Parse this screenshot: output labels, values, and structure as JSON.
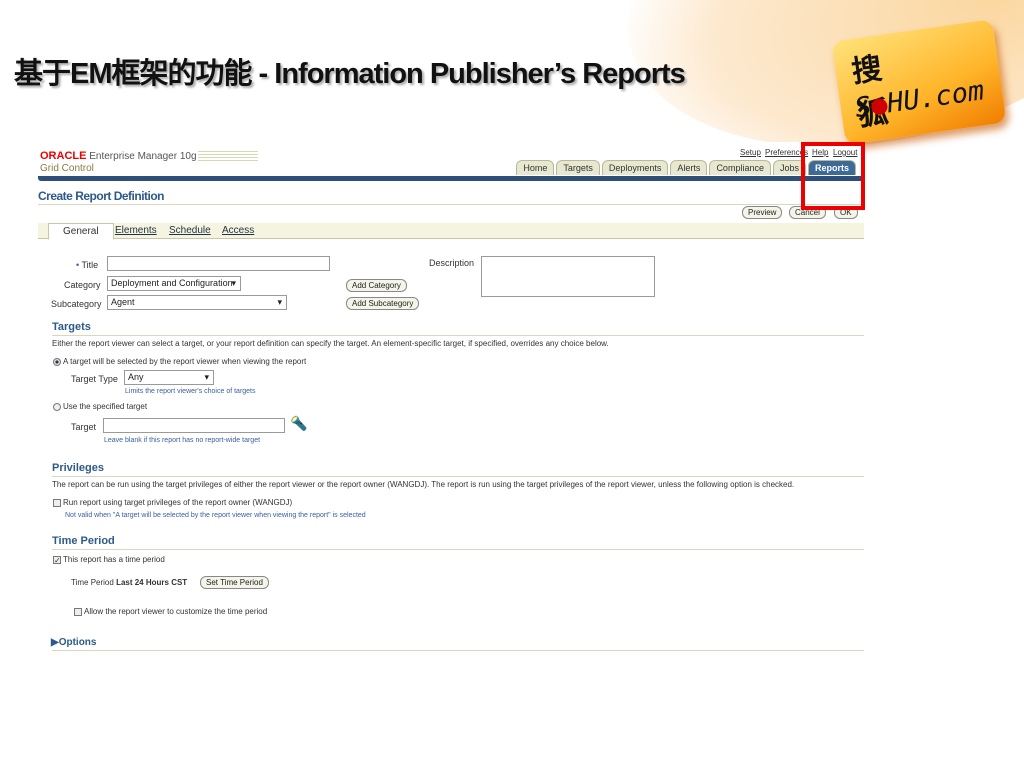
{
  "slide": {
    "title": "基于EM框架的功能 - Information Publisher’s Reports",
    "logo_cn": "搜 狐",
    "logo_en_pre": "S",
    "logo_en_dot": "●",
    "logo_en_post": "HU.com"
  },
  "app": {
    "oracle": "ORACLE",
    "product": "Enterprise Manager 10g",
    "subtitle": "Grid Control"
  },
  "global_links": [
    "Setup",
    "Preferences",
    "Help",
    "Logout"
  ],
  "tabs": [
    "Home",
    "Targets",
    "Deployments",
    "Alerts",
    "Compliance",
    "Jobs",
    "Reports"
  ],
  "page": {
    "title": "Create Report Definition",
    "buttons": {
      "preview": "Preview",
      "cancel": "Cancel",
      "ok": "OK"
    }
  },
  "subtabs": [
    "General",
    "Elements",
    "Schedule",
    "Access"
  ],
  "form": {
    "title_label": "Title",
    "title_value": "",
    "category_label": "Category",
    "category_value": "Deployment and Configuration",
    "subcategory_label": "Subcategory",
    "subcategory_value": "Agent",
    "add_category": "Add Category",
    "add_subcategory": "Add Subcategory",
    "description_label": "Description",
    "description_value": ""
  },
  "targets": {
    "heading": "Targets",
    "desc": "Either the report viewer can select a target, or your report definition can specify the target. An element-specific target, if specified, overrides any choice below.",
    "option1": "A target will be selected by the report viewer when viewing the report",
    "target_type_label": "Target Type",
    "target_type_value": "Any",
    "target_type_help": "Limits the report viewer's choice of targets",
    "option2": "Use the specified target",
    "target_label": "Target",
    "target_value": "",
    "target_help": "Leave blank if this report has no report-wide target"
  },
  "privileges": {
    "heading": "Privileges",
    "desc": "The report can be run using the target privileges of either the report viewer or the report owner (WANGDJ). The report is run using the target privileges of the report viewer, unless the following option is checked.",
    "checkbox": "Run report using target privileges of the report owner (WANGDJ)",
    "help": "Not valid when \"A target will be selected by the report viewer when viewing the report\" is selected"
  },
  "time_period": {
    "heading": "Time Period",
    "checkbox": "This report has a time period",
    "label": "Time Period",
    "value": "Last 24 Hours CST",
    "button": "Set Time Period",
    "allow": "Allow the report viewer to customize the time period"
  },
  "options": {
    "heading": "Options"
  }
}
